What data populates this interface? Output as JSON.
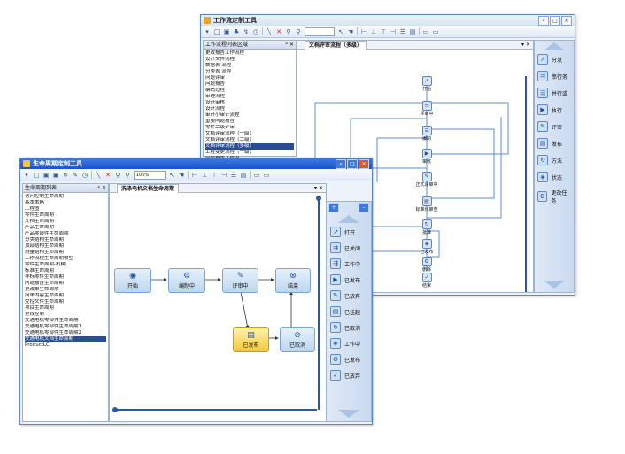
{
  "back_window": {
    "title": "工作流定制工具",
    "list_header": "工作流程列表区域",
    "list_items": [
      "更改报告工作流程",
      "设计文件流程",
      "数据表 流程",
      "分类表 流程",
      "问题评审",
      "问题报告",
      "编码过程",
      "审理流程",
      "设计审核",
      "设计流程",
      "审计小审计流程",
      "重要问题报告",
      "零件二级评审",
      "文档评审流程（一级）",
      "文档评审流程（二级）",
      "文档评审流程（多级）",
      "工程变更流程（一级）",
      "问题报告工作流"
    ],
    "selected_index": 15,
    "tab_label": "文档评审流程（多级）",
    "flow_nodes": [
      "开始",
      "评审中",
      "编制",
      "审核",
      "正式评审中",
      "标准化审查",
      "批准",
      "已发布",
      "删除",
      "结束"
    ],
    "side_items": [
      "分发",
      "串行务",
      "并行或",
      "执行",
      "评审",
      "发布",
      "方法",
      "状态",
      "更改任务"
    ]
  },
  "front_window": {
    "title": "生命周期定制工具",
    "zoom": "100%",
    "list_header": "生命周期列表",
    "list_items": [
      "访问控制生命周期",
      "基本策略",
      "工程图",
      "零件生命周期",
      "文档生命周期",
      "产品生命周期",
      "产品零部件生命周期",
      "分类结构生命周期",
      "顶部结构生命周期",
      "测量结构生命周期",
      "工作流程生命周期模型",
      "零件生命周期-机械",
      "标准生命周期",
      "非标零件生命周期",
      "问题报告生命周期",
      "更改单生命周期",
      "简单内容生命周期",
      "受控文件生命周期",
      "项目生命周期",
      "更改控制",
      "交通电机零部件生命周期",
      "交通电机零部件生命周期1",
      "交通电机零部件生命周期2",
      "交通电机文档生命周期",
      "ProductLC"
    ],
    "selected_index": 23,
    "tab_label": "洗涤电机文档生命周期",
    "nodes": {
      "start": "开始",
      "compile": "编制中",
      "review": "评审中",
      "end": "结束",
      "released": "已发布",
      "cancelled": "已取消"
    },
    "side_items": [
      "打开",
      "已关闭",
      "工作中",
      "已发布",
      "已放弃",
      "已挂起",
      "已取消",
      "工作中",
      "已发布",
      "已放弃"
    ]
  },
  "labels": {
    "close_x": "✕",
    "pin": "ᵖ ✕",
    "tab_close": "▾ ✕"
  }
}
